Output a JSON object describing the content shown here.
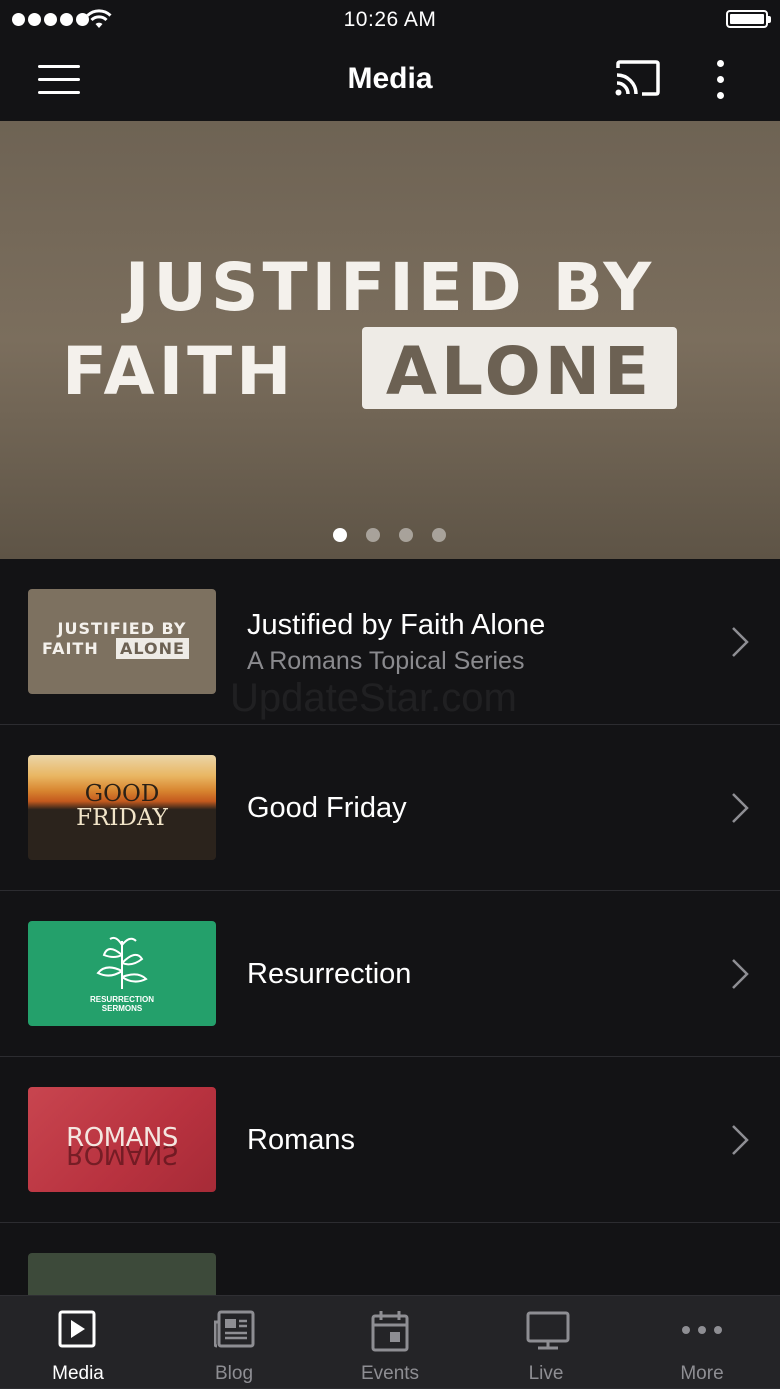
{
  "status_bar": {
    "time": "10:26 AM"
  },
  "navbar": {
    "title": "Media"
  },
  "hero": {
    "line1": "JUSTIFIED BY",
    "line2": "FAITH",
    "highlight": "ALONE",
    "slides_count": 4,
    "active_slide": 1
  },
  "series": [
    {
      "title": "Justified by Faith Alone",
      "subtitle": "A Romans Topical Series",
      "thumb": {
        "line1": "JUSTIFIED BY",
        "line2": "FAITH",
        "highlight": "ALONE"
      }
    },
    {
      "title": "Good Friday",
      "thumb": {
        "line1": "GOOD",
        "line2": "FRIDAY"
      }
    },
    {
      "title": "Resurrection",
      "thumb": {
        "caption_line1": "RESURRECTION",
        "caption_line2": "SERMONS"
      }
    },
    {
      "title": "Romans",
      "thumb": {
        "text": "ROMANS"
      }
    },
    {
      "title": "",
      "thumb": {
        "text": ""
      }
    }
  ],
  "watermark": "UpdateStar.com",
  "tabs": [
    {
      "label": "Media",
      "icon": "media-play-icon",
      "active": true
    },
    {
      "label": "Blog",
      "icon": "blog-icon",
      "active": false
    },
    {
      "label": "Events",
      "icon": "calendar-icon",
      "active": false
    },
    {
      "label": "Live",
      "icon": "tv-icon",
      "active": false
    },
    {
      "label": "More",
      "icon": "more-dots-icon",
      "active": false
    }
  ],
  "colors": {
    "background": "#131315",
    "tab_bar": "#242427",
    "active_tab": "#ffffff",
    "inactive_tab": "#8e8e93",
    "subtitle": "#8a8a8e"
  }
}
